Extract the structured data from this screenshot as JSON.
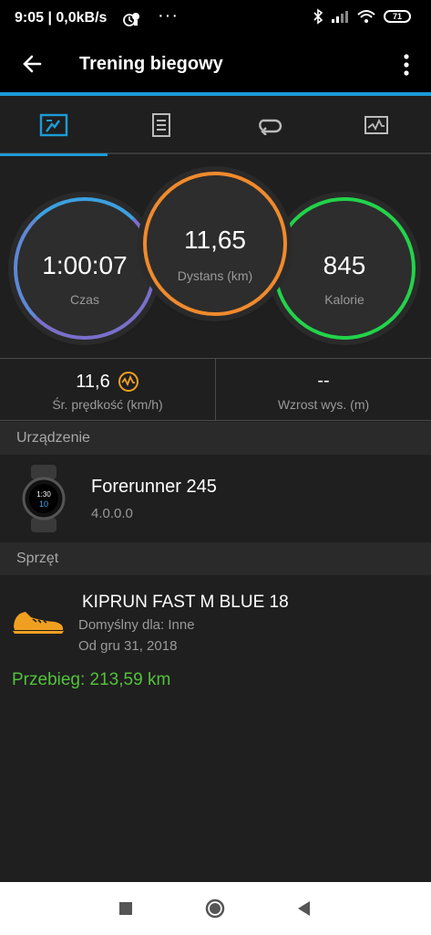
{
  "status": {
    "time_net": "9:05 | 0,0kB/s",
    "battery": "71"
  },
  "appbar": {
    "title": "Trening biegowy"
  },
  "tabs": [
    "summary-icon",
    "details-icon",
    "laps-icon",
    "charts-icon"
  ],
  "rings": {
    "time": {
      "value": "1:00:07",
      "label": "Czas"
    },
    "distance": {
      "value": "11,65",
      "label": "Dystans (km)"
    },
    "calories": {
      "value": "845",
      "label": "Kalorie"
    }
  },
  "stats": {
    "speed": {
      "value": "11,6",
      "label": "Śr. prędkość (km/h)"
    },
    "elevation": {
      "value": "--",
      "label": "Wzrost wys. (m)"
    }
  },
  "sections": {
    "device": "Urządzenie",
    "gear": "Sprzęt"
  },
  "device": {
    "name": "Forerunner 245",
    "version": "4.0.0.0"
  },
  "gear": {
    "name": "KIPRUN FAST M BLUE 18",
    "default_for": "Domyślny dla: Inne",
    "since": "Od gru 31, 2018",
    "distance": "Przebieg: 213,59 km"
  },
  "colors": {
    "accent": "#1d9bd7",
    "distance_ring": "#f08a2c",
    "calories_ring": "#22d34a",
    "gear_distance": "#52c23a"
  }
}
